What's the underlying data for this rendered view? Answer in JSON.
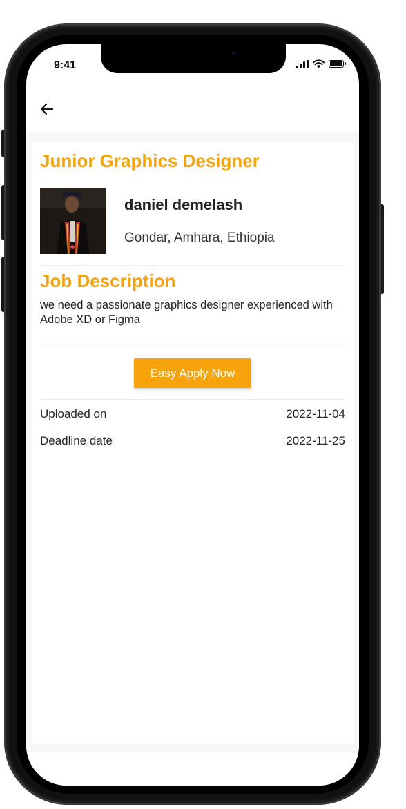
{
  "status_bar": {
    "time": "9:41",
    "icons": [
      "signal-icon",
      "wifi-icon",
      "battery-icon"
    ]
  },
  "app_bar": {
    "back_icon": "arrow-left-icon"
  },
  "job": {
    "title": "Junior Graphics Designer",
    "poster": {
      "name": "daniel demelash",
      "location": "Gondar, Amhara, Ethiopia"
    },
    "description_heading": "Job Description",
    "description": "we need a passionate graphics designer experienced with Adobe XD or Figma",
    "apply_label": "Easy Apply Now",
    "details": [
      {
        "label": "Uploaded on",
        "value": "2022-11-04"
      },
      {
        "label": "Deadline date",
        "value": "2022-11-25"
      }
    ]
  },
  "colors": {
    "accent": "#f4a40a",
    "button": "#f7a40c",
    "text": "#222222",
    "background": "#f7f7f7"
  }
}
